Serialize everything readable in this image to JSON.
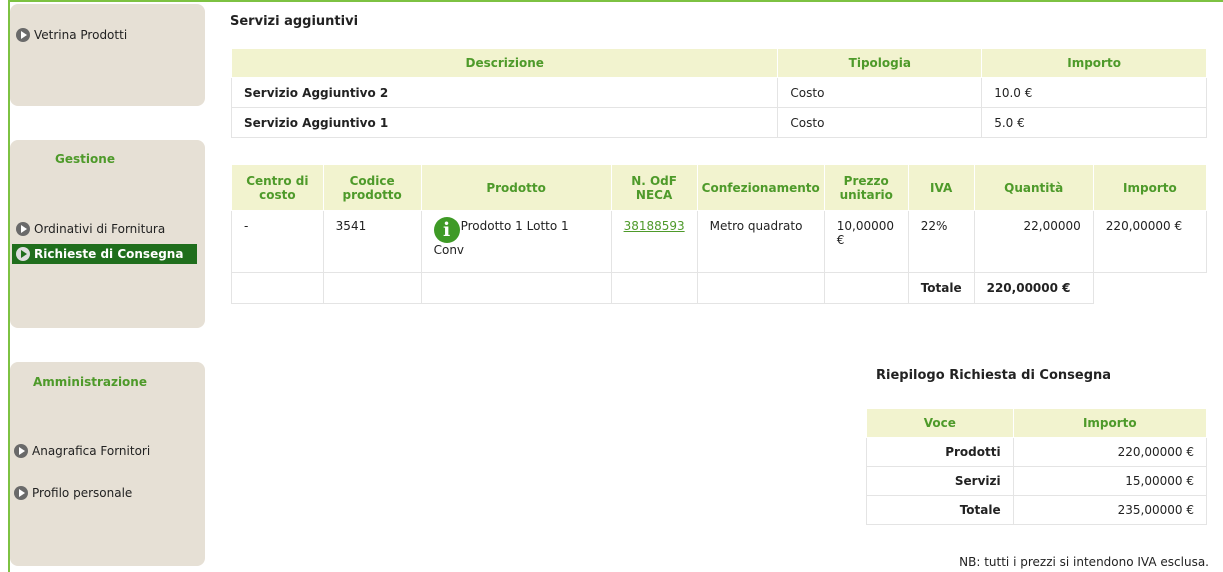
{
  "sidebar": {
    "top_link": "Vetrina Prodotti",
    "gestione": {
      "title": "Gestione",
      "items": [
        "Ordinativi di Fornitura",
        "Richieste di Consegna"
      ]
    },
    "amministrazione": {
      "title": "Amministrazione",
      "items": [
        "Anagrafica Fornitori",
        "Profilo personale"
      ]
    }
  },
  "servizi": {
    "title": "Servizi aggiuntivi",
    "headers": [
      "Descrizione",
      "Tipologia",
      "Importo"
    ],
    "rows": [
      {
        "descrizione": "Servizio Aggiuntivo 2",
        "tipologia": "Costo",
        "importo": "10.0 €"
      },
      {
        "descrizione": "Servizio Aggiuntivo 1",
        "tipologia": "Costo",
        "importo": "5.0 €"
      }
    ]
  },
  "prodotti": {
    "headers": {
      "centro": "Centro di costo",
      "codice": "Codice prodotto",
      "prodotto": "Prodotto",
      "odf": "N. OdF NECA",
      "conf": "Confezionamento",
      "prezzo": "Prezzo unitario",
      "iva": "IVA",
      "quantita": "Quantità",
      "importo": "Importo"
    },
    "row": {
      "centro": "-",
      "codice": "3541",
      "prodotto": "Prodotto 1 Lotto 1 Conv",
      "odf": "38188593",
      "conf": "Metro quadrato",
      "prezzo": "10,00000 €",
      "iva": "22%",
      "quantita": "22,00000",
      "importo": "220,00000 €"
    },
    "totale_label": "Totale",
    "totale_value": "220,00000 €"
  },
  "riepilogo": {
    "title": "Riepilogo Richiesta di Consegna",
    "headers": [
      "Voce",
      "Importo"
    ],
    "rows": [
      {
        "voce": "Prodotti",
        "importo": "220,00000 €"
      },
      {
        "voce": "Servizi",
        "importo": "15,00000 €"
      },
      {
        "voce": "Totale",
        "importo": "235,00000 €"
      }
    ]
  },
  "note": "NB: tutti i prezzi si intendono IVA esclusa.",
  "colors": {
    "accent": "#4e9a2a",
    "header_bg": "#f2f3cf",
    "active_bg": "#1f6e1c",
    "sidebar_bg": "#e6e0d5"
  }
}
